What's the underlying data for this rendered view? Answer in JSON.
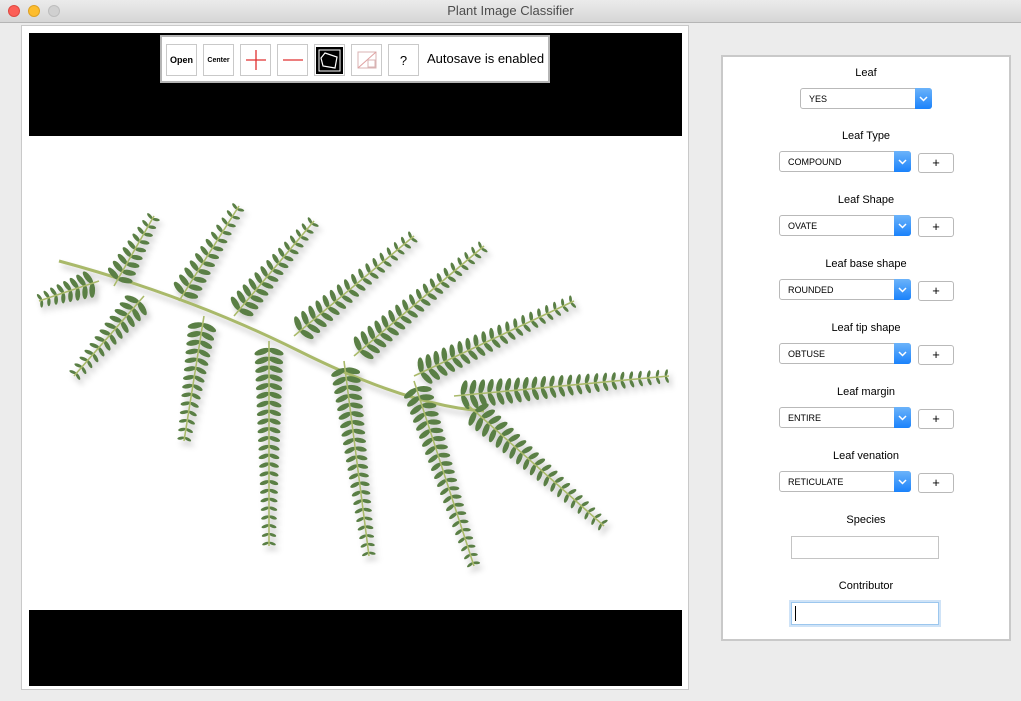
{
  "window": {
    "title": "Plant Image Classifier"
  },
  "toolbar": {
    "open_label": "Open",
    "center_label": "Center",
    "zoom_in_icon": "plus-icon",
    "zoom_out_icon": "minus-icon",
    "polygon_icon": "polygon-icon",
    "no_image_icon": "no-image-icon",
    "help_label": "?",
    "autosave_text": "Autosave is enabled"
  },
  "form": {
    "leaf": {
      "label": "Leaf",
      "value": "YES"
    },
    "leaf_type": {
      "label": "Leaf Type",
      "value": "COMPOUND",
      "add": "+"
    },
    "leaf_shape": {
      "label": "Leaf Shape",
      "value": "OVATE",
      "add": "+"
    },
    "leaf_base_shape": {
      "label": "Leaf base shape",
      "value": "ROUNDED",
      "add": "+"
    },
    "leaf_tip_shape": {
      "label": "Leaf tip shape",
      "value": "OBTUSE",
      "add": "+"
    },
    "leaf_margin": {
      "label": "Leaf margin",
      "value": "ENTIRE",
      "add": "+"
    },
    "leaf_venation": {
      "label": "Leaf venation",
      "value": "RETICULATE",
      "add": "+"
    },
    "species": {
      "label": "Species",
      "value": ""
    },
    "contributor": {
      "label": "Contributor",
      "value": ""
    }
  },
  "colors": {
    "accent": "#1a82fb",
    "leaf_green": "#5a7f45",
    "stem": "#a9b96a"
  }
}
